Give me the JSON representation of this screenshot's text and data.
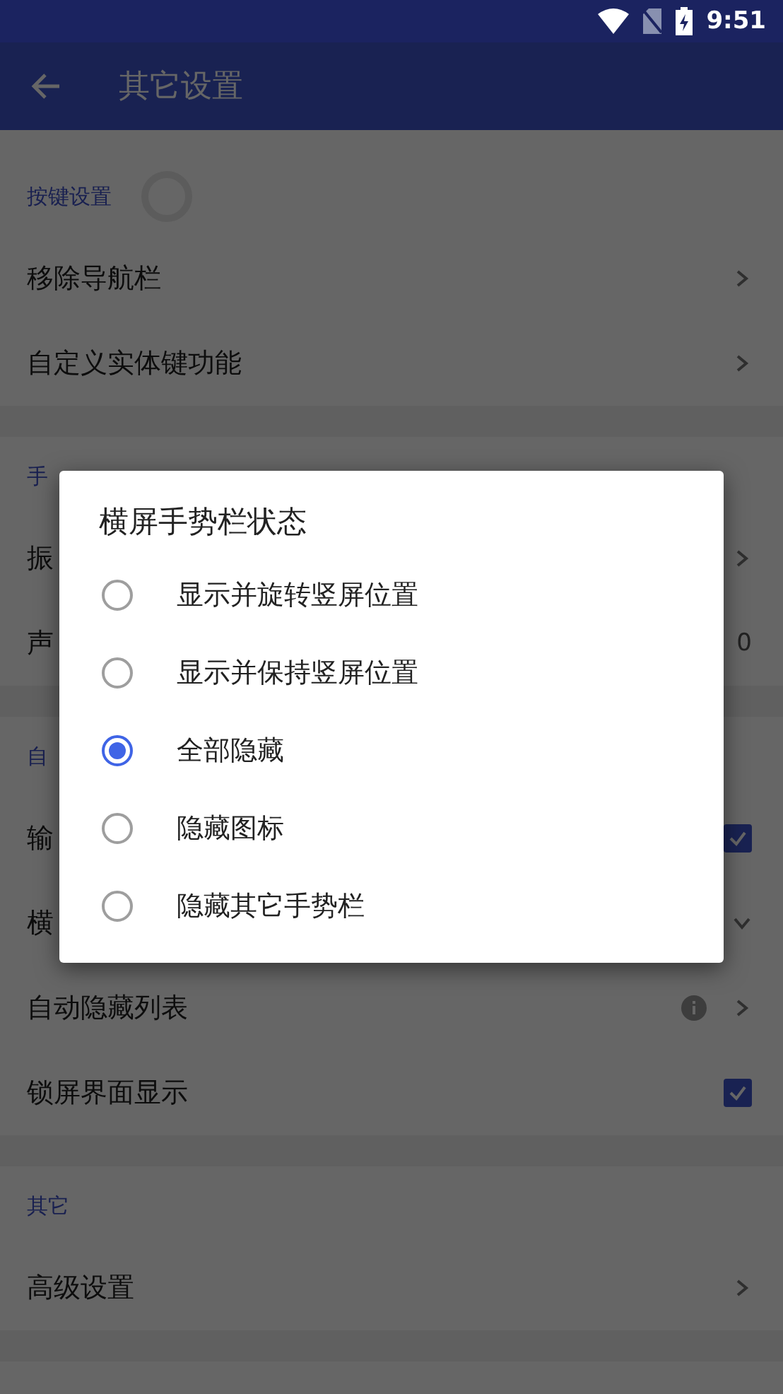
{
  "status_bar": {
    "time": "9:51"
  },
  "app_bar": {
    "title": "其它设置"
  },
  "sections": [
    {
      "header": "按键设置",
      "loading": true,
      "items": [
        {
          "label": "移除导航栏",
          "kind": "link"
        },
        {
          "label": "自定义实体键功能",
          "kind": "link"
        }
      ]
    },
    {
      "header": "手",
      "loading": false,
      "items": [
        {
          "label": "振",
          "kind": "link"
        },
        {
          "label": "声",
          "kind": "value",
          "value": "0"
        }
      ]
    },
    {
      "header": "自",
      "loading": false,
      "items": [
        {
          "label": "输",
          "kind": "checkbox",
          "checked": true
        },
        {
          "label": "横",
          "kind": "dropdown"
        },
        {
          "label": "自动隐藏列表",
          "kind": "info_link"
        },
        {
          "label": "锁屏界面显示",
          "kind": "checkbox",
          "checked": true
        }
      ]
    },
    {
      "header": "其它",
      "loading": false,
      "items": [
        {
          "label": "高级设置",
          "kind": "link"
        }
      ]
    }
  ],
  "dialog": {
    "title": "横屏手势栏状态",
    "options": [
      {
        "label": "显示并旋转竖屏位置",
        "selected": false
      },
      {
        "label": "显示并保持竖屏位置",
        "selected": false
      },
      {
        "label": "全部隐藏",
        "selected": true
      },
      {
        "label": "隐藏图标",
        "selected": false
      },
      {
        "label": "隐藏其它手势栏",
        "selected": false
      }
    ]
  }
}
